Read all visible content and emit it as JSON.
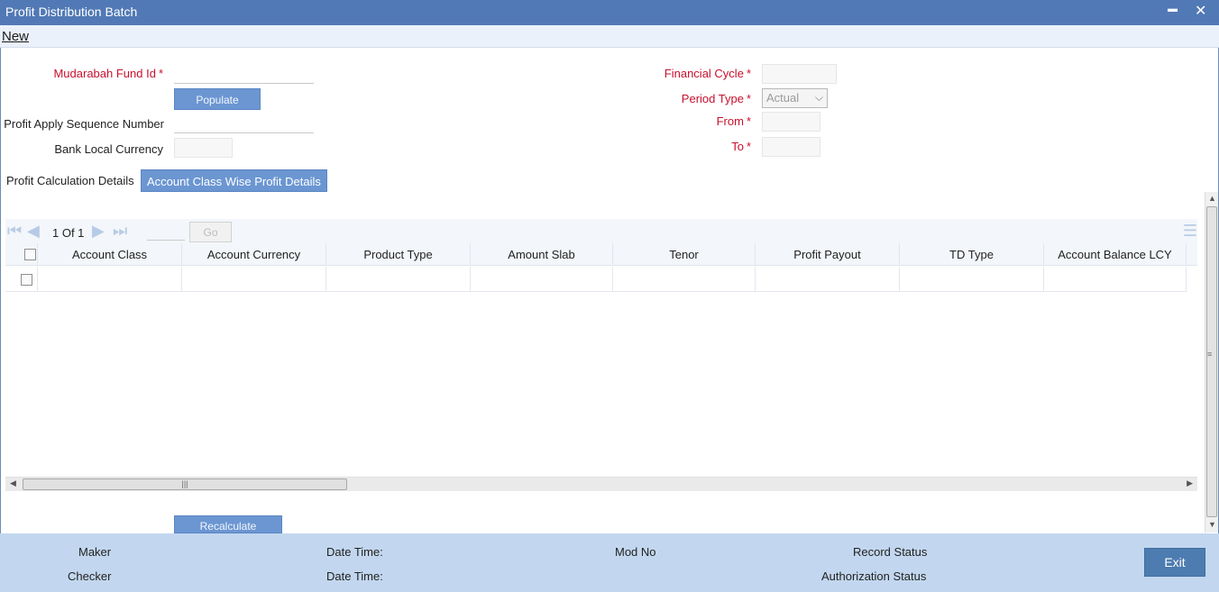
{
  "window": {
    "title": "Profit Distribution Batch",
    "minimize": "▬",
    "close": "✕"
  },
  "menu": {
    "new_label": "New"
  },
  "form": {
    "fund_id_label": "Mudarabah Fund Id",
    "fund_id_value": "",
    "populate_label": "Populate",
    "sequence_label": "Profit Apply Sequence Number",
    "sequence_value": "",
    "currency_label": "Bank Local Currency",
    "currency_value": "",
    "financial_cycle_label": "Financial Cycle",
    "financial_cycle_value": "",
    "period_type_label": "Period Type",
    "period_type_value": "Actual",
    "from_label": "From",
    "from_value": "",
    "to_label": "To",
    "to_value": "",
    "required_mark": "*"
  },
  "tabs": [
    {
      "label": "Profit Calculation Details",
      "active": false
    },
    {
      "label": "Account Class Wise Profit Details",
      "active": true
    }
  ],
  "grid": {
    "pager_text": "1 Of 1",
    "go_label": "Go",
    "columns": [
      "Account Class",
      "Account Currency",
      "Product Type",
      "Amount Slab",
      "Tenor",
      "Profit Payout",
      "TD Type",
      "Account Balance LCY"
    ]
  },
  "recalculate_label": "Recalculate",
  "footer": {
    "maker": "Maker",
    "checker": "Checker",
    "date_time_1": "Date Time:",
    "date_time_2": "Date Time:",
    "mod_no": "Mod No",
    "record_status": "Record Status",
    "authorization_status": "Authorization Status",
    "exit_label": "Exit"
  },
  "colors": {
    "title_bar": "#5179b5",
    "button": "#6b96d2",
    "required": "#c8102e",
    "footer": "#c2d7ef",
    "exit": "#4d7cb0"
  }
}
